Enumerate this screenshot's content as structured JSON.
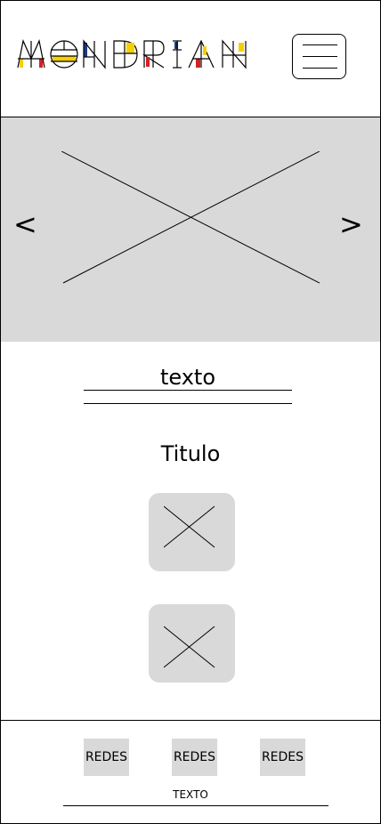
{
  "header": {
    "logo_text": "MONDRIAN",
    "logo_colors": {
      "yellow": "#f5d000",
      "red": "#d32027",
      "blue": "#1e3a8a",
      "black": "#000000"
    },
    "menu_icon": "hamburger-icon"
  },
  "carousel": {
    "prev_label": "<",
    "next_label": ">",
    "placeholder_icon": "image-placeholder-icon"
  },
  "text_field": {
    "value": "texto"
  },
  "section": {
    "title": "Titulo"
  },
  "thumbnails": [
    {
      "icon": "image-placeholder-icon"
    },
    {
      "icon": "image-placeholder-icon"
    }
  ],
  "footer": {
    "social": [
      {
        "label": "REDES"
      },
      {
        "label": "REDES"
      },
      {
        "label": "REDES"
      }
    ],
    "text": "TEXTO"
  },
  "colors": {
    "placeholder_gray": "#d9d9d9"
  }
}
